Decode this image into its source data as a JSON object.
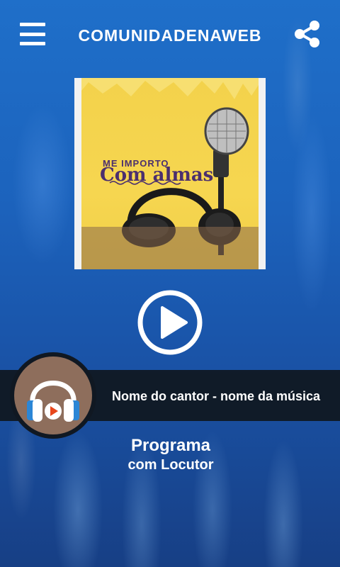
{
  "header": {
    "title": "COMUNIDADENAWEB",
    "menu_icon": "hamburger-menu-icon",
    "share_icon": "share-icon"
  },
  "cover": {
    "line1": "ME IMPORTO",
    "line2": "Com almas"
  },
  "player": {
    "play_icon": "play-icon",
    "now_playing": "Nome do cantor - nome da música",
    "station_icon": "headphones-icon"
  },
  "program": {
    "title": "Programa",
    "host": "com Locutor"
  },
  "colors": {
    "background": "#1c63bd",
    "bar": "#101822",
    "cover_yellow": "#f3d24b",
    "cover_text": "#4b2f6e",
    "logo_brown": "#8e6e5c",
    "headphone_blue": "#2b86d6",
    "play_orange": "#e8471c"
  }
}
